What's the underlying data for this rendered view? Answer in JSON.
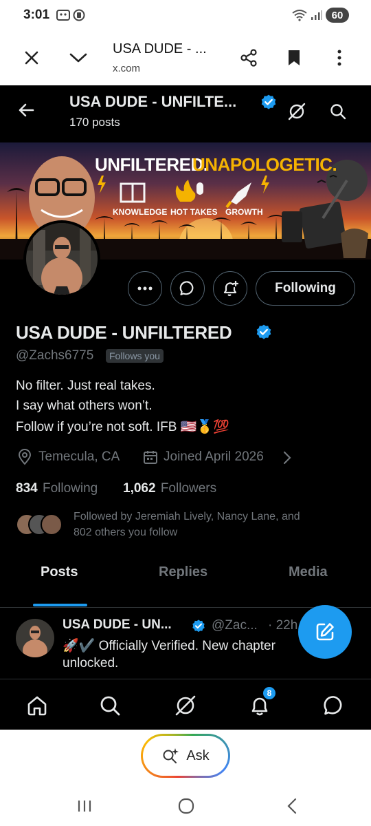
{
  "status_bar": {
    "time": "3:01",
    "battery": "60"
  },
  "browser": {
    "title": "USA DUDE - ...",
    "url": "x.com"
  },
  "header": {
    "name": "USA DUDE - UNFILTE...",
    "posts_count": "170 posts"
  },
  "banner": {
    "headline_a": "UNFILTERED.",
    "headline_b": "UNAPOLOGETIC.",
    "badges": [
      "KNOWLEDGE",
      "HOT TAKES",
      "GROWTH"
    ]
  },
  "profile": {
    "follow_button": "Following",
    "display_name": "USA DUDE - UNFILTERED",
    "handle": "@Zachs6775",
    "follows_you": "Follows you",
    "bio_lines": [
      "No filter. Just real takes.",
      "I say what others won’t.",
      "Follow if you’re not soft. IFB 🇺🇸🥇💯"
    ],
    "location": "Temecula, CA",
    "joined": "Joined April 2026",
    "following_count": "834",
    "following_label": "Following",
    "followers_count": "1,062",
    "followers_label": "Followers",
    "followed_by_line1": "Followed by Jeremiah Lively, Nancy Lane, and",
    "followed_by_line2": "802 others you follow"
  },
  "tabs": [
    {
      "label": "Posts",
      "active": true
    },
    {
      "label": "Replies",
      "active": false
    },
    {
      "label": "Media",
      "active": false
    }
  ],
  "post": {
    "name": "USA DUDE - UN...",
    "handle": "@Zac...",
    "time": "· 22h",
    "text_line1": "🚀✔️ Officially Verified. New chapter",
    "text_line2": "unlocked."
  },
  "bottom_nav": {
    "notifications_badge": "8"
  },
  "assistant": {
    "ask_label": "Ask"
  },
  "colors": {
    "verified": "#1d9bf0",
    "accent": "#1d9bf0",
    "background": "#000000",
    "banner_gold": "#f5b301"
  }
}
